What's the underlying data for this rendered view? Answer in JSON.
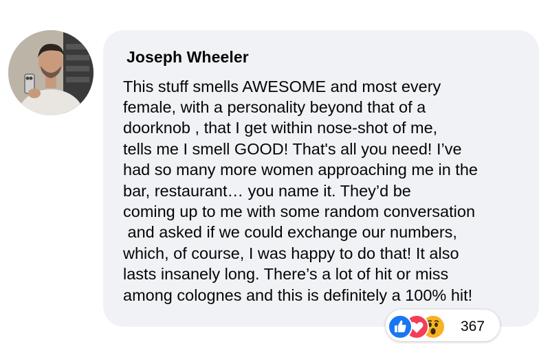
{
  "comment": {
    "author": "Joseph Wheeler",
    "text_lines": [
      "This stuff smells AWESOME and most every",
      "female, with a personality beyond that of a",
      "doorknob , that I get within nose-shot of me,",
      "tells me I smell GOOD! That's all you need! I’ve",
      "had so many more women approaching me in the",
      "bar, restaurant… you name it. They’d be",
      "coming up to me with some random conversation",
      " and asked if we could exchange our numbers,",
      "which, of course, I was happy to do that! It also",
      "lasts insanely long. There’s a lot of hit or miss",
      "among colognes and this is definitely a 100% hit!"
    ]
  },
  "reactions": {
    "icons": [
      "like-icon",
      "love-icon",
      "wow-icon"
    ],
    "count": "367",
    "colors": {
      "like": "#1877f2",
      "love": "#f33e58",
      "wow": "#f7b125"
    }
  },
  "colors": {
    "bubble": "#f0f2f5",
    "text": "#050505"
  }
}
